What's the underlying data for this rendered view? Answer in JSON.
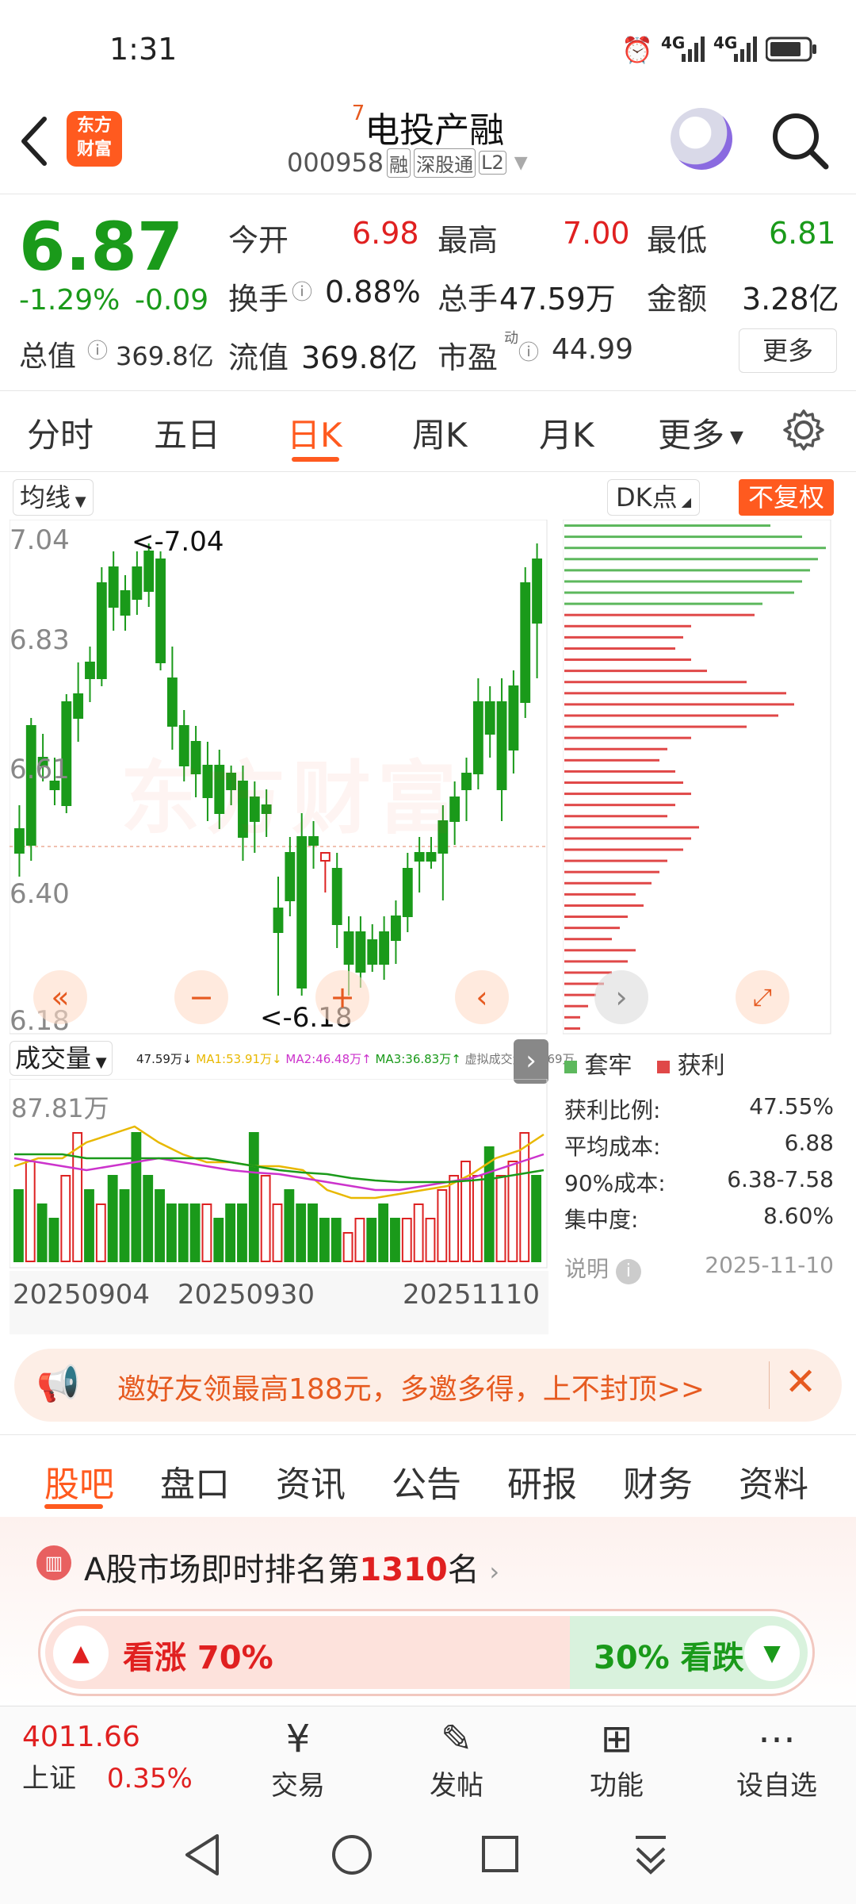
{
  "status_bar": {
    "time": "1:31",
    "signal1": "4G",
    "signal2": "4G"
  },
  "header": {
    "logo_line1": "东方",
    "logo_line2": "财富",
    "title_prefix": "7",
    "title": "电投产融",
    "code": "000958",
    "tag_rong": "融",
    "tag_sgt": "深股通",
    "tag_l2": "L2"
  },
  "quote": {
    "price": "6.87",
    "change_pct": "-1.29%",
    "change_amt": "-0.09",
    "open_label": "今开",
    "open": "6.98",
    "high_label": "最高",
    "high": "7.00",
    "low_label": "最低",
    "low": "6.81",
    "turnover_label": "换手",
    "turnover": "0.88%",
    "volume_label": "总手",
    "volume": "47.59万",
    "amount_label": "金额",
    "amount": "3.28亿",
    "total_value_label": "总值",
    "total_value": "369.8亿",
    "float_value_label": "流值",
    "float_value": "369.8亿",
    "pe_label": "市盈",
    "pe_sup": "动",
    "pe": "44.99",
    "more_label": "更多"
  },
  "kline_tabs": [
    "分时",
    "五日",
    "日K",
    "周K",
    "月K",
    "更多"
  ],
  "kline_active": "日K",
  "chart_controls": {
    "ma_label": "均线",
    "dk_label": "DK点",
    "adjust_label": "不复权",
    "watermark": "东方财富"
  },
  "kline": {
    "y_ticks": [
      "7.04",
      "6.83",
      "6.61",
      "6.40",
      "6.18"
    ],
    "high_marker": "<-7.04",
    "low_marker": "<-6.18"
  },
  "volume": {
    "label": "成交量",
    "legend_vol": "47.59万↓",
    "legend_ma1": "MA1:53.91万↓",
    "legend_ma2": "MA2:46.48万↑",
    "legend_ma3": "MA3:36.83万↑",
    "legend_virtual": "虚拟成交量:64.69万",
    "max_label": "87.81万",
    "dates": [
      "20250904",
      "20250930",
      "20251110"
    ],
    "ma1_color": "#e8b800",
    "ma2_color": "#cc33cc",
    "ma3_color": "#1a9a1a"
  },
  "chip": {
    "legend_trapped": "套牢",
    "legend_profit": "获利",
    "rows": [
      {
        "label": "获利比例:",
        "value": "47.55%"
      },
      {
        "label": "平均成本:",
        "value": "6.88"
      },
      {
        "label": "90%成本:",
        "value": "6.38-7.58"
      },
      {
        "label": "集中度:",
        "value": "8.60%"
      }
    ],
    "note_label": "说明",
    "date": "2025-11-10"
  },
  "banner": {
    "text": "邀好友领最高188元，多邀多得，上不封顶>>"
  },
  "bottom_tabs": [
    "股吧",
    "盘口",
    "资讯",
    "公告",
    "研报",
    "财务",
    "资料"
  ],
  "bottom_tab_active": "股吧",
  "ranking": {
    "prefix": "A股市场即时排名第",
    "rank": "1310",
    "suffix": "名"
  },
  "sentiment": {
    "up_label": "看涨 70%",
    "down_label": "30% 看跌",
    "up_fraction": 0.7
  },
  "bottom_bar": {
    "index_value": "4011.66",
    "index_name": "上证",
    "index_change": "0.35%",
    "items": [
      "交易",
      "发帖",
      "功能",
      "设自选"
    ]
  },
  "colors": {
    "up": "#e02020",
    "down": "#1a9a1a",
    "accent": "#ff5a1f"
  }
}
